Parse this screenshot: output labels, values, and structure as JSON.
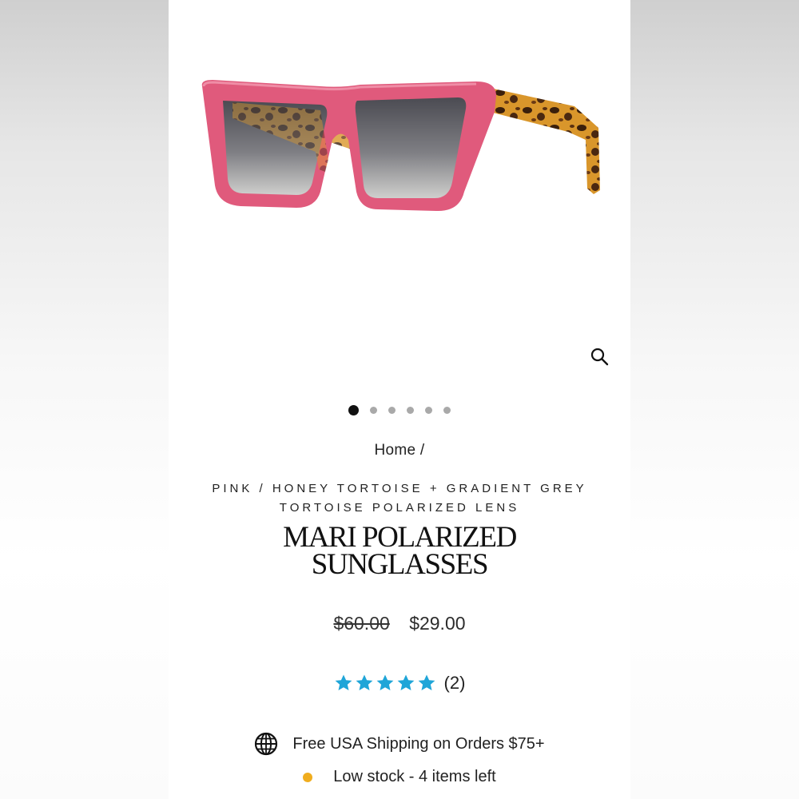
{
  "colors": {
    "frame_pink": "#e05a7c",
    "star_blue": "#1fa5d8",
    "stock_dot": "#f0ad1e",
    "dot_active": "#111111",
    "dot_inactive": "#a9a9a9"
  },
  "gallery": {
    "image_alt": "Pink cat-eye sunglasses with honey tortoise temples",
    "zoom_icon": "search-icon",
    "slides": [
      {
        "active": true
      },
      {
        "active": false
      },
      {
        "active": false
      },
      {
        "active": false
      },
      {
        "active": false
      },
      {
        "active": false
      }
    ]
  },
  "breadcrumb": {
    "home": "Home /"
  },
  "product": {
    "variant_line1": "PINK / HONEY TORTOISE + GRADIENT GREY",
    "variant_line2": "TORTOISE POLARIZED LENS",
    "title_line1": "MARI POLARIZED",
    "title_line2": "SUNGLASSES",
    "price_original": "$60.00",
    "price_sale": "$29.00",
    "rating": 5,
    "review_count": "(2)"
  },
  "info": {
    "shipping_icon": "globe-icon",
    "shipping_text": "Free USA Shipping on Orders $75+",
    "stock_text": "Low stock - 4 items left"
  }
}
